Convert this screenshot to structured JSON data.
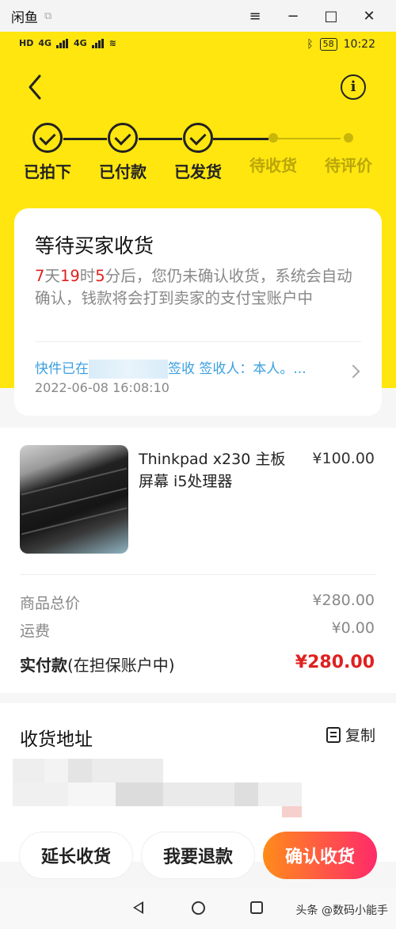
{
  "window": {
    "app_name": "闲鱼",
    "minimize": "−",
    "maximize": "□",
    "close": "✕",
    "menu": "≡"
  },
  "status_bar": {
    "network_left": "HD",
    "signal1": "4G",
    "signal2": "4G",
    "battery": "58",
    "time": "10:22"
  },
  "steps": [
    {
      "label": "已拍下",
      "state": "done"
    },
    {
      "label": "已付款",
      "state": "done"
    },
    {
      "label": "已发货",
      "state": "done"
    },
    {
      "label": "待收货",
      "state": "pending"
    },
    {
      "label": "待评价",
      "state": "pending"
    }
  ],
  "status_card": {
    "title": "等待买家收货",
    "days": "7",
    "days_unit": "天",
    "hours": "19",
    "hours_unit": "时",
    "minutes": "5",
    "minutes_unit": "分后，您仍未确认收货，系统会自动确认，钱款将会打到卖家的支付宝账户中",
    "tracking_prefix": "快件已在",
    "tracking_suffix": "签收 签收人：本人。...",
    "tracking_time": "2022-06-08 16:08:10"
  },
  "product": {
    "name": "Thinkpad x230 主板  屏幕  i5处理器",
    "price": "¥100.00"
  },
  "summary": {
    "goods_total_label": "商品总价",
    "goods_total_value": "¥280.00",
    "shipping_label": "运费",
    "shipping_value": "¥0.00",
    "paid_label": "实付款",
    "paid_note": "(在担保账户中)",
    "paid_value": "¥280.00"
  },
  "address": {
    "heading": "收货地址",
    "copy_label": "复制"
  },
  "actions": {
    "extend": "延长收货",
    "refund": "我要退款",
    "confirm": "确认收货"
  },
  "watermark": "头条 @数码小能手",
  "colors": {
    "header_yellow": "#ffe60f",
    "accent_red": "#e02020",
    "link_blue": "#3aa0e0"
  }
}
